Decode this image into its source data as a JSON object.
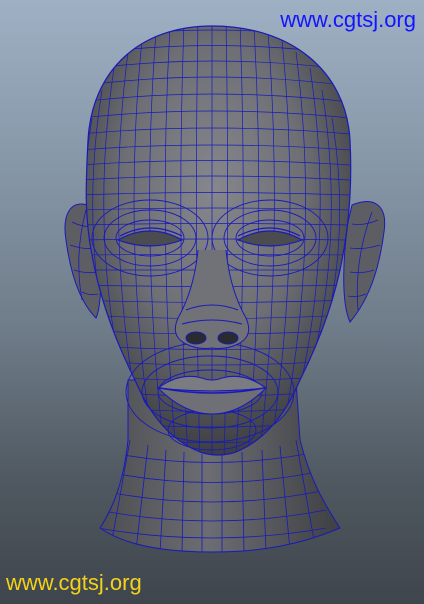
{
  "viewport": {
    "background_top": "#9eb0c3",
    "background_bottom": "#3f454c"
  },
  "model": {
    "subject": "head-wireframe-model",
    "surface_color": "#6b6d72",
    "wire_color": "#1a1ab8"
  },
  "watermarks": {
    "top_text": "www.cgtsj.org",
    "top_color": "#1414ff",
    "bottom_text": "www.cgtsj.org",
    "bottom_color": "#f2d21a"
  }
}
